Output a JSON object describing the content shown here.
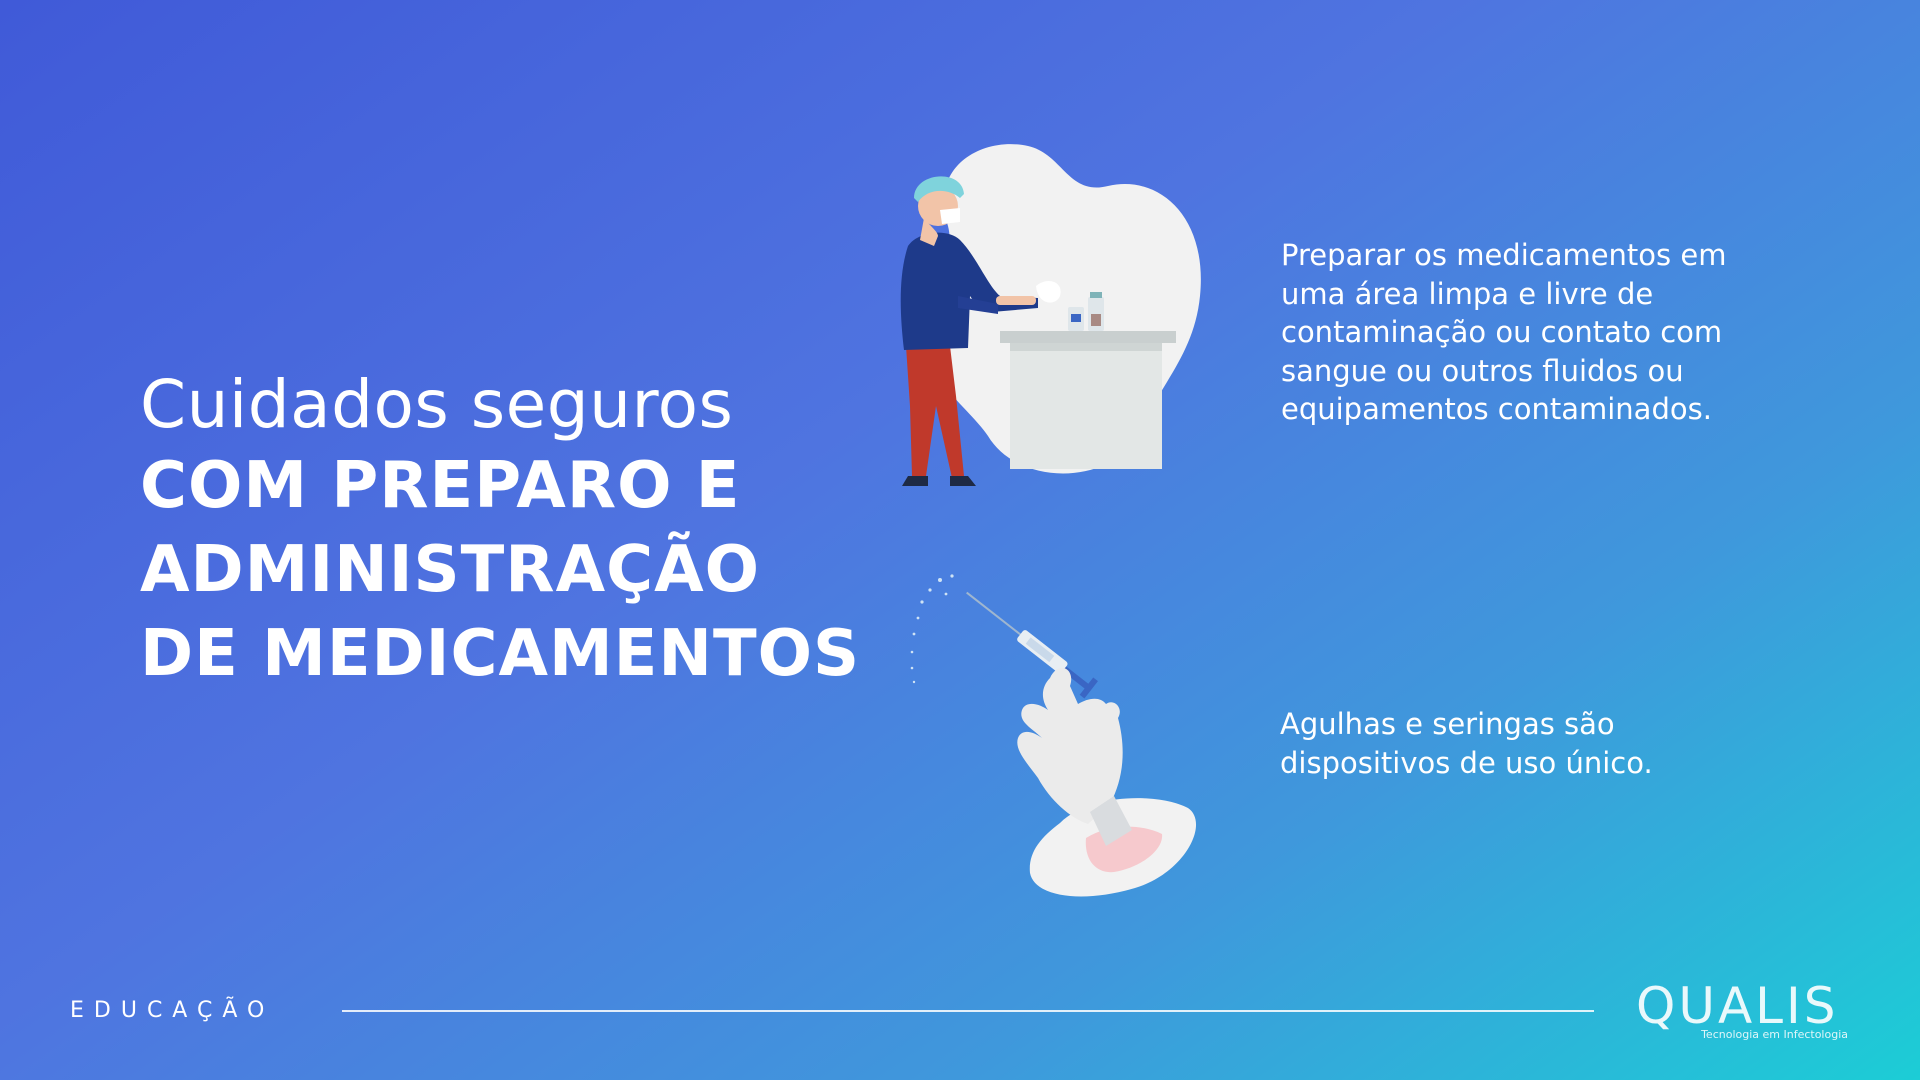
{
  "headline": {
    "light": "Cuidados seguros",
    "bold_lines": [
      "COM PREPARO E",
      "ADMINISTRAÇÃO",
      "DE MEDICAMENTOS"
    ]
  },
  "points": [
    {
      "lines": [
        "Preparar os medicamentos em",
        "uma área limpa e livre de",
        "contaminação ou contato com",
        "sangue ou outros fluidos ou",
        "equipamentos contaminados."
      ],
      "illustration": "nurse-preparing-medication-icon"
    },
    {
      "lines": [
        "Agulhas e seringas são",
        "dispositivos de uso único."
      ],
      "illustration": "gloved-hand-syringe-icon"
    }
  ],
  "footer": {
    "label": "EDUCAÇÃO"
  },
  "logo": {
    "word": "QUALIS",
    "tagline": "Tecnologia em Infectologia"
  },
  "colors": {
    "gradient_start": "#405ad8",
    "gradient_mid": "#4f74e0",
    "gradient_end": "#1ccdd6",
    "nurse_shirt": "#1e3a8a",
    "nurse_pants": "#c0392b",
    "cap": "#7fd3dc",
    "blob": "#f2f2f2"
  }
}
